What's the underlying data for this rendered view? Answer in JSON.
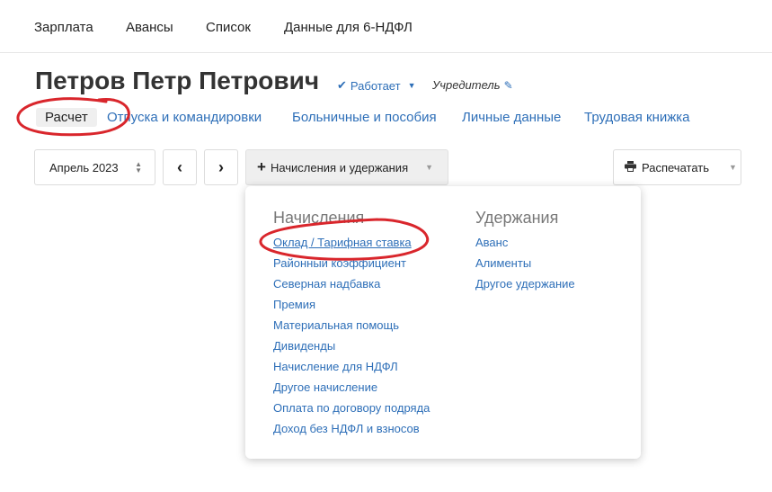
{
  "topnav": {
    "items": [
      "Зарплата",
      "Авансы",
      "Список",
      "Данные для 6-НДФЛ"
    ]
  },
  "employee": {
    "name": "Петров Петр Петрович",
    "status": "Работает",
    "role": "Учредитель"
  },
  "tabs": [
    "Расчет",
    "Отпуска и командировки",
    "Больничные и пособия",
    "Личные данные",
    "Трудовая книжка"
  ],
  "toolbar": {
    "month": "Апрель 2023",
    "prev": "‹",
    "next": "›",
    "accruals_button": "Начисления и удержания",
    "print_button": "Распечатать"
  },
  "dropdown": {
    "accruals": {
      "title": "Начисления",
      "items": [
        "Оклад / Тарифная ставка",
        "Районный коэффициент",
        "Северная надбавка",
        "Премия",
        "Материальная помощь",
        "Дивиденды",
        "Начисление для НДФЛ",
        "Другое начисление",
        "Оплата по договору подряда",
        "Доход без НДФЛ и взносов"
      ]
    },
    "deductions": {
      "title": "Удержания",
      "items": [
        "Аванс",
        "Алименты",
        "Другое удержание"
      ]
    }
  },
  "colors": {
    "link": "#2e6fb8",
    "annotation": "#d9262c",
    "active_tab_bg": "#efefef"
  },
  "icons": [
    "check-icon",
    "caret-down-icon",
    "pencil-icon",
    "up-down-arrows-icon",
    "chevron-left-icon",
    "chevron-right-icon",
    "plus-icon",
    "printer-icon"
  ]
}
